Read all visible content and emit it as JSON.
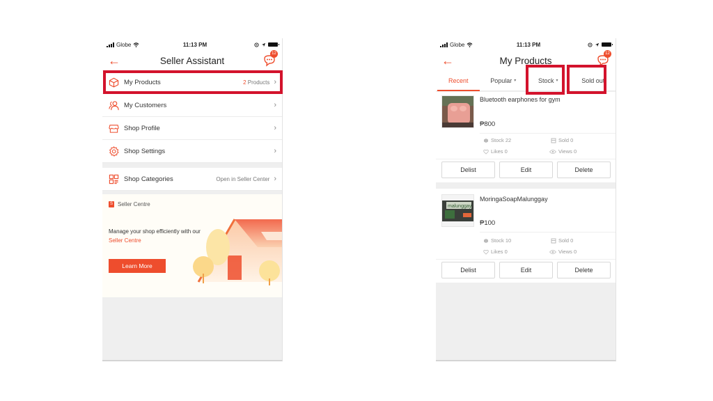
{
  "status_bar": {
    "carrier": "Globe",
    "time": "11:13 PM"
  },
  "left_screen": {
    "title": "Seller Assistant",
    "chat_badge": "12",
    "menu": [
      {
        "label": "My Products",
        "meta_count": "2",
        "meta_suffix": " Products",
        "icon": "box-icon"
      },
      {
        "label": "My Customers",
        "icon": "customers-icon"
      },
      {
        "label": "Shop Profile",
        "icon": "shop-icon"
      },
      {
        "label": "Shop Settings",
        "icon": "gear-icon"
      },
      {
        "label": "Shop Categories",
        "meta": "Open in Seller Center",
        "icon": "categories-icon"
      }
    ],
    "seller_centre": {
      "heading": "Seller Centre",
      "bag_glyph": "S",
      "text": "Manage your shop efficiently with our",
      "link": "Seller Centre",
      "button": "Learn More"
    }
  },
  "right_screen": {
    "title": "My Products",
    "chat_badge": "12",
    "tabs": [
      {
        "label": "Recent",
        "active": true
      },
      {
        "label": "Popular",
        "caret": "▾"
      },
      {
        "label": "Stock",
        "caret": "▾"
      },
      {
        "label": "Sold out"
      }
    ],
    "products": [
      {
        "name": "Bluetooth earphones for gym",
        "price": "₱800",
        "stock": "Stock 22",
        "sold": "Sold 0",
        "likes": "Likes 0",
        "views": "Views 0",
        "actions": [
          "Delist",
          "Edit",
          "Delete"
        ]
      },
      {
        "name": "MoringaSoapMalunggay",
        "price": "₱100",
        "stock": "Stock 10",
        "sold": "Sold 0",
        "likes": "Likes 0",
        "views": "Views 0",
        "actions": [
          "Delist",
          "Edit",
          "Delete"
        ]
      }
    ]
  },
  "colors": {
    "accent": "#ee4d2d",
    "highlight": "#d3132c"
  }
}
